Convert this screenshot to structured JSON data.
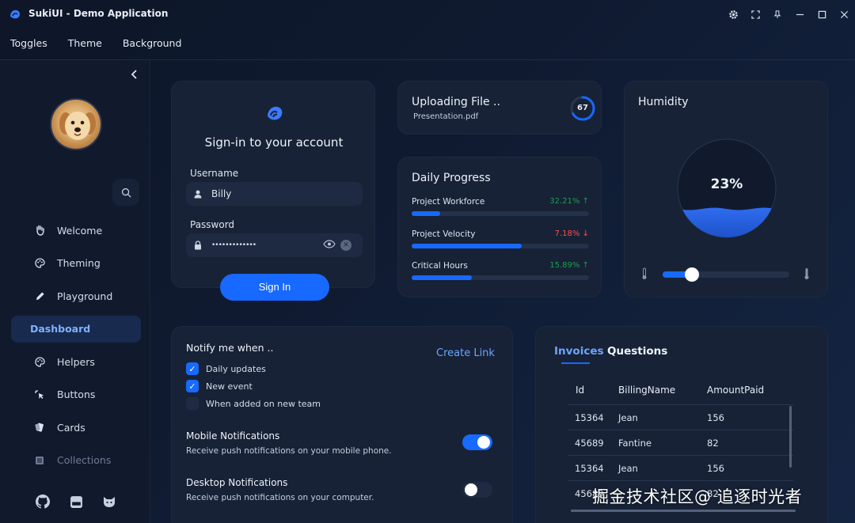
{
  "window": {
    "title": "SukiUI - Demo Application"
  },
  "menu": [
    "Toggles",
    "Theme",
    "Background"
  ],
  "sidebar": {
    "items": [
      {
        "label": "Welcome",
        "icon": "hand-wave-icon"
      },
      {
        "label": "Theming",
        "icon": "palette-icon"
      },
      {
        "label": "Playground",
        "icon": "pencil-icon"
      },
      {
        "label": "Dashboard",
        "icon": "",
        "active": true
      },
      {
        "label": "Helpers",
        "icon": "palette-icon"
      },
      {
        "label": "Buttons",
        "icon": "cursor-click-icon"
      },
      {
        "label": "Cards",
        "icon": "cards-icon"
      },
      {
        "label": "Collections",
        "icon": "collection-icon"
      }
    ]
  },
  "signin": {
    "heading": "Sign-in to your account",
    "username_label": "Username",
    "username_value": "Billy",
    "password_label": "Password",
    "password_value": "•••••••••••••",
    "button": "Sign In"
  },
  "upload": {
    "title": "Uploading File ..",
    "file": "Presentation.pdf",
    "percent": "67",
    "progress": 0.67
  },
  "daily_progress": {
    "title": "Daily Progress",
    "rows": [
      {
        "label": "Project Workforce",
        "value": "32.21%",
        "trend": "up",
        "fill": 0.16
      },
      {
        "label": "Project Velocity",
        "value": "7.18%",
        "trend": "down",
        "fill": 0.62
      },
      {
        "label": "Critical Hours",
        "value": "15.89%",
        "trend": "up",
        "fill": 0.34
      }
    ]
  },
  "humidity": {
    "title": "Humidity",
    "value": "23%",
    "level": 0.23,
    "slider": 0.23
  },
  "notify": {
    "title": "Notify me when ..",
    "create_link": "Create Link",
    "options": [
      {
        "label": "Daily updates",
        "checked": true
      },
      {
        "label": "New event",
        "checked": true
      },
      {
        "label": "When added on new team",
        "checked": false
      }
    ],
    "mobile": {
      "title": "Mobile Notifications",
      "desc": "Receive push notifications on your mobile phone.",
      "on": true
    },
    "desktop": {
      "title": "Desktop Notifications",
      "desc": "Receive push notifications on your computer.",
      "on": false
    }
  },
  "invoices": {
    "tabs": [
      "Invoices",
      "Questions"
    ],
    "columns": [
      "Id",
      "BillingName",
      "AmountPaid"
    ],
    "rows": [
      [
        "15364",
        "Jean",
        "156"
      ],
      [
        "45689",
        "Fantine",
        "82"
      ],
      [
        "15364",
        "Jean",
        "156"
      ],
      [
        "45689",
        "",
        "82"
      ]
    ]
  },
  "watermark": "掘金技术社区@ 追逐时光者",
  "colors": {
    "accent": "#1769ff",
    "up": "#1f9d4c",
    "down": "#ff4d4d",
    "link": "#6ea4ff"
  }
}
